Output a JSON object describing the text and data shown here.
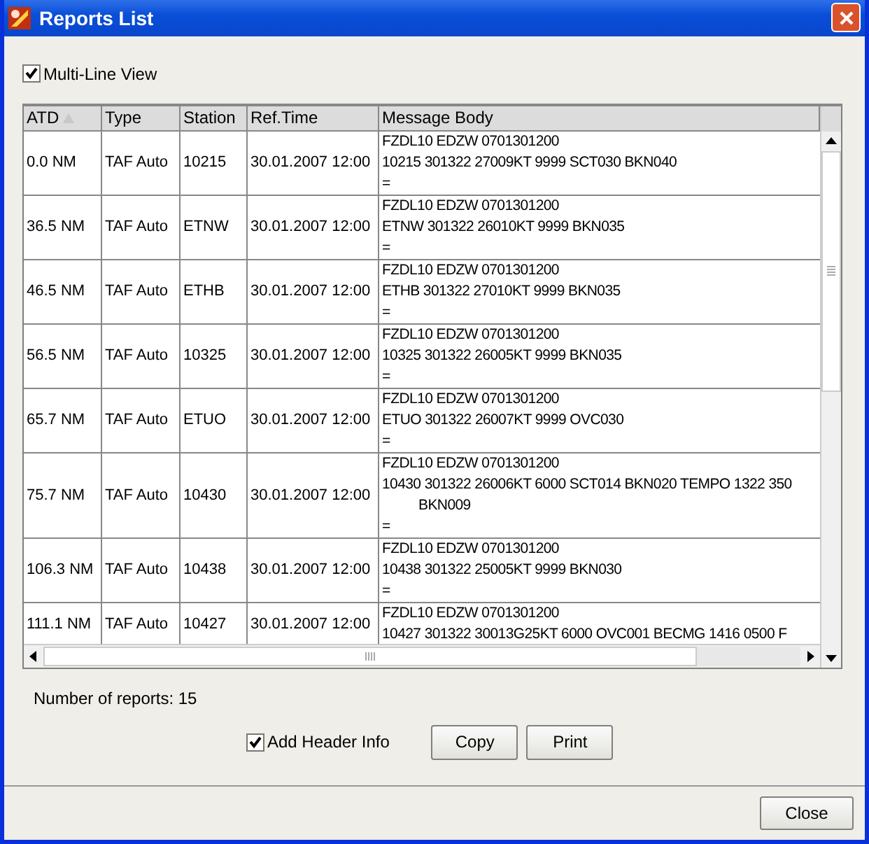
{
  "window": {
    "title": "Reports List"
  },
  "multi_line_view": {
    "label": "Multi-Line View",
    "checked": true
  },
  "table": {
    "columns": [
      {
        "label": "ATD",
        "sorted": true
      },
      {
        "label": "Type",
        "sorted": false
      },
      {
        "label": "Station",
        "sorted": false
      },
      {
        "label": "Ref.Time",
        "sorted": false
      },
      {
        "label": "Message Body",
        "sorted": false
      }
    ],
    "rows": [
      {
        "atd": "0.0 NM",
        "type": "TAF Auto",
        "station": "10215",
        "ref_time": "30.01.2007 12:00",
        "message": [
          {
            "text": "FZDL10 EDZW 0701301200",
            "wrapped": false
          },
          {
            "text": "10215 301322 27009KT 9999 SCT030 BKN040",
            "wrapped": false
          },
          {
            "text": "=",
            "wrapped": false
          }
        ]
      },
      {
        "atd": "36.5 NM",
        "type": "TAF Auto",
        "station": "ETNW",
        "ref_time": "30.01.2007 12:00",
        "message": [
          {
            "text": "FZDL10 EDZW 0701301200",
            "wrapped": false
          },
          {
            "text": "ETNW 301322 26010KT 9999 BKN035",
            "wrapped": false
          },
          {
            "text": "=",
            "wrapped": false
          }
        ]
      },
      {
        "atd": "46.5 NM",
        "type": "TAF Auto",
        "station": "ETHB",
        "ref_time": "30.01.2007 12:00",
        "message": [
          {
            "text": "FZDL10 EDZW 0701301200",
            "wrapped": false
          },
          {
            "text": "ETHB 301322 27010KT 9999 BKN035",
            "wrapped": false
          },
          {
            "text": "=",
            "wrapped": false
          }
        ]
      },
      {
        "atd": "56.5 NM",
        "type": "TAF Auto",
        "station": "10325",
        "ref_time": "30.01.2007 12:00",
        "message": [
          {
            "text": "FZDL10 EDZW 0701301200",
            "wrapped": false
          },
          {
            "text": "10325 301322 26005KT 9999 BKN035",
            "wrapped": false
          },
          {
            "text": "=",
            "wrapped": false
          }
        ]
      },
      {
        "atd": "65.7 NM",
        "type": "TAF Auto",
        "station": "ETUO",
        "ref_time": "30.01.2007 12:00",
        "message": [
          {
            "text": "FZDL10 EDZW 0701301200",
            "wrapped": false
          },
          {
            "text": "ETUO 301322 26007KT 9999 OVC030",
            "wrapped": false
          },
          {
            "text": "=",
            "wrapped": false
          }
        ]
      },
      {
        "atd": "75.7 NM",
        "type": "TAF Auto",
        "station": "10430",
        "ref_time": "30.01.2007 12:00",
        "message": [
          {
            "text": "FZDL10 EDZW 0701301200",
            "wrapped": false
          },
          {
            "text": "10430 301322 26006KT 6000 SCT014 BKN020 TEMPO 1322 350",
            "wrapped": false
          },
          {
            "text": "BKN009",
            "wrapped": true
          },
          {
            "text": "=",
            "wrapped": false
          }
        ]
      },
      {
        "atd": "106.3 NM",
        "type": "TAF Auto",
        "station": "10438",
        "ref_time": "30.01.2007 12:00",
        "message": [
          {
            "text": "FZDL10 EDZW 0701301200",
            "wrapped": false
          },
          {
            "text": "10438 301322 25005KT 9999 BKN030",
            "wrapped": false
          },
          {
            "text": "=",
            "wrapped": false
          }
        ]
      },
      {
        "atd": "111.1 NM",
        "type": "TAF Auto",
        "station": "10427",
        "ref_time": "30.01.2007 12:00",
        "message": [
          {
            "text": "FZDL10 EDZW 0701301200",
            "wrapped": false
          },
          {
            "text": "10427 301322 30013G25KT 6000 OVC001 BECMG 1416 0500 F",
            "wrapped": false
          }
        ]
      }
    ]
  },
  "report_count": "Number of reports: 15",
  "add_header_info": {
    "label": "Add Header Info",
    "checked": true
  },
  "buttons": [
    "Copy",
    "Print"
  ],
  "close_button": "Close"
}
